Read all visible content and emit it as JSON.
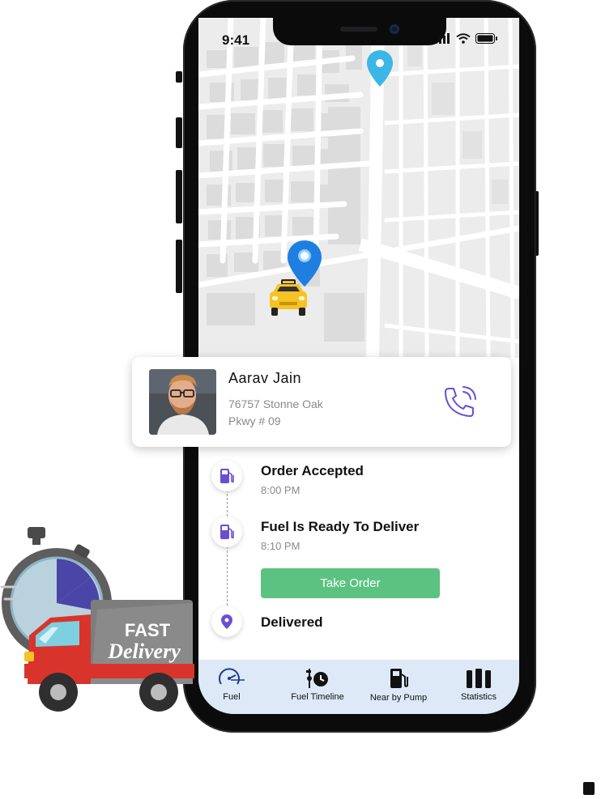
{
  "status_bar": {
    "time": "9:41"
  },
  "driver": {
    "name": "Aarav Jain",
    "address_line1": "76757 Stonne Oak",
    "address_line2": "Pkwy # 09"
  },
  "timeline": [
    {
      "title": "Order Accepted",
      "time": "8:00 PM",
      "icon": "fuel-pump-icon"
    },
    {
      "title": "Fuel Is Ready To Deliver",
      "time": "8:10 PM",
      "icon": "fuel-pump-icon"
    },
    {
      "title": "Delivered",
      "time": "",
      "icon": "location-pin-icon"
    }
  ],
  "take_order_label": "Take Order",
  "bottom_nav": [
    {
      "label": "Fuel",
      "icon": "fuel-gauge-icon"
    },
    {
      "label": "Fuel Timeline",
      "icon": "fuel-timeline-icon"
    },
    {
      "label": "Near by Pump",
      "icon": "fuel-pump-icon"
    },
    {
      "label": "Statistics",
      "icon": "bar-chart-icon"
    }
  ],
  "badge": {
    "line1": "FAST",
    "line2": "Delivery"
  },
  "colors": {
    "accent": "#6a4fd3",
    "pin_blue": "#1f7fe0",
    "pin_cyan": "#3cb6e6",
    "take_order": "#5cc281",
    "nav_bg": "#dde9f7",
    "taxi": "#f6c324"
  }
}
